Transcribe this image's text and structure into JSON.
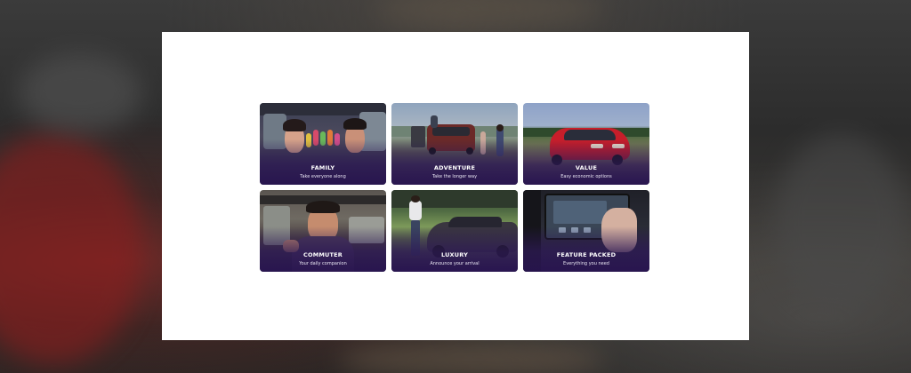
{
  "cards": [
    {
      "title": "FAMILY",
      "subtitle": "Take everyone along"
    },
    {
      "title": "ADVENTURE",
      "subtitle": "Take the longer way"
    },
    {
      "title": "VALUE",
      "subtitle": "Easy economic options"
    },
    {
      "title": "COMMUTER",
      "subtitle": "Your daily companion"
    },
    {
      "title": "LUXURY",
      "subtitle": "Announce your arrival"
    },
    {
      "title": "FEATURE PACKED",
      "subtitle": "Everything you need"
    }
  ]
}
